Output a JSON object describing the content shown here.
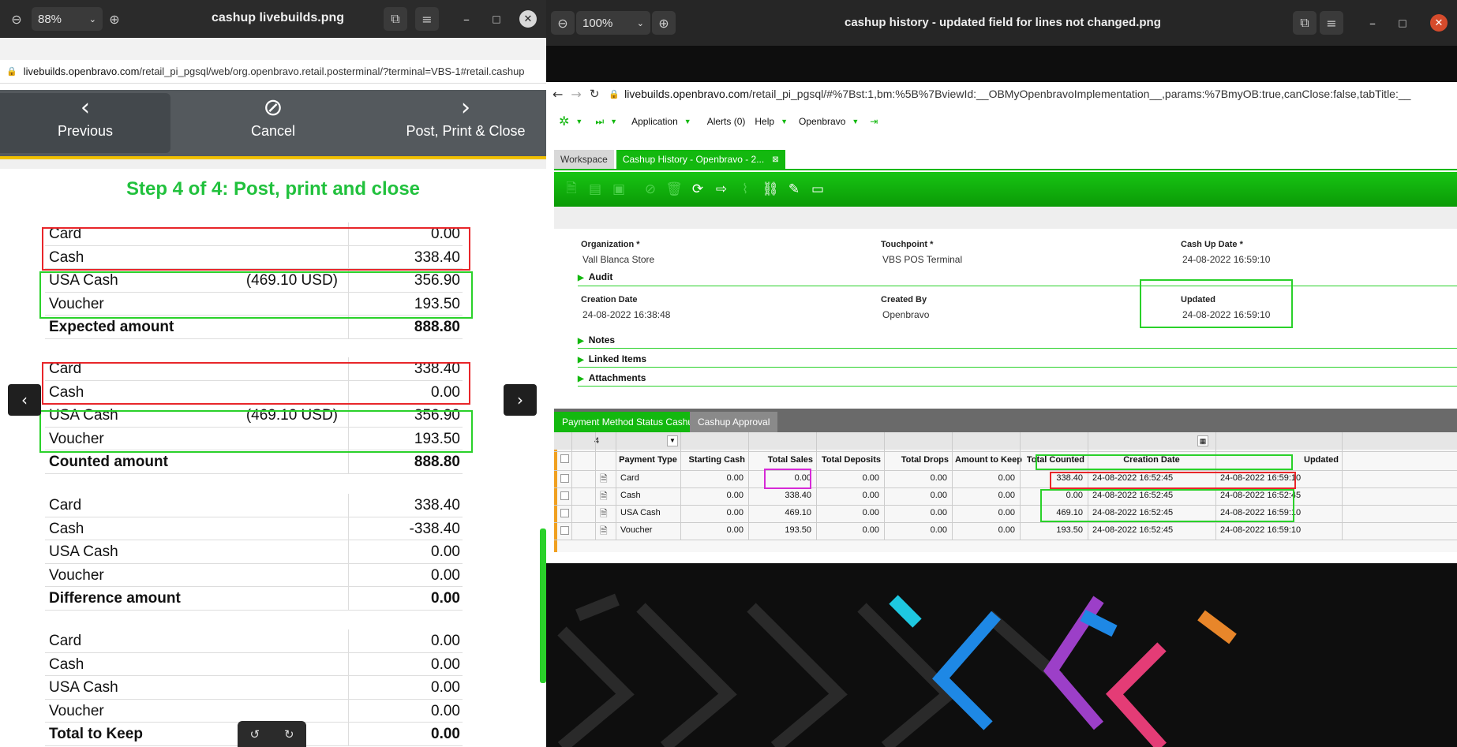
{
  "left_window": {
    "zoom": "88%",
    "title": "cashup livebuilds.png",
    "url_host": "livebuilds.openbravo.com",
    "url_path": "/retail_pi_pgsql/web/org.openbravo.retail.posterminal/?terminal=VBS-1#retail.cashup",
    "toolbar": {
      "previous": "Previous",
      "cancel": "Cancel",
      "post": "Post, Print & Close"
    },
    "step_title": "Step 4 of 4: Post, print and close",
    "expected": [
      {
        "name": "Card",
        "extra": "",
        "value": "0.00"
      },
      {
        "name": "Cash",
        "extra": "",
        "value": "338.40"
      },
      {
        "name": "USA Cash",
        "extra": "(469.10 USD)",
        "value": "356.90"
      },
      {
        "name": "Voucher",
        "extra": "",
        "value": "193.50"
      },
      {
        "name": "Expected amount",
        "extra": "",
        "value": "888.80"
      }
    ],
    "counted": [
      {
        "name": "Card",
        "extra": "",
        "value": "338.40"
      },
      {
        "name": "Cash",
        "extra": "",
        "value": "0.00"
      },
      {
        "name": "USA Cash",
        "extra": "(469.10 USD)",
        "value": "356.90"
      },
      {
        "name": "Voucher",
        "extra": "",
        "value": "193.50"
      },
      {
        "name": "Counted amount",
        "extra": "",
        "value": "888.80"
      }
    ],
    "difference": [
      {
        "name": "Card",
        "extra": "",
        "value": "338.40"
      },
      {
        "name": "Cash",
        "extra": "",
        "value": "-338.40"
      },
      {
        "name": "USA Cash",
        "extra": "",
        "value": "0.00"
      },
      {
        "name": "Voucher",
        "extra": "",
        "value": "0.00"
      },
      {
        "name": "Difference amount",
        "extra": "",
        "value": "0.00"
      }
    ],
    "keep": [
      {
        "name": "Card",
        "extra": "",
        "value": "0.00"
      },
      {
        "name": "Cash",
        "extra": "",
        "value": "0.00"
      },
      {
        "name": "USA Cash",
        "extra": "",
        "value": "0.00"
      },
      {
        "name": "Voucher",
        "extra": "",
        "value": "0.00"
      },
      {
        "name": "Total to Keep",
        "extra": "",
        "value": "0.00"
      }
    ]
  },
  "right_window": {
    "zoom": "100%",
    "title": "cashup history - updated field for lines not changed.png",
    "url_host": "livebuilds.openbravo.com",
    "url_path": "/retail_pi_pgsql/#%7Bst:1,bm:%5B%7BviewId:__OBMyOpenbravoImplementation__,params:%7BmyOB:true,canClose:false,tabTitle:__",
    "menu": {
      "application": "Application",
      "alerts": "Alerts (0)",
      "help": "Help",
      "openbravo": "Openbravo"
    },
    "tabs": {
      "workspace": "Workspace",
      "cashup": "Cashup History - Openbravo - 2..."
    },
    "form": {
      "organization_label": "Organization *",
      "organization": "Vall Blanca Store",
      "touchpoint_label": "Touchpoint *",
      "touchpoint": "VBS POS Terminal",
      "cashupdate_label": "Cash Up Date *",
      "cashupdate": "24-08-2022 16:59:10",
      "audit": "Audit",
      "creation_label": "Creation Date",
      "creation": "24-08-2022 16:38:48",
      "createdby_label": "Created By",
      "createdby": "Openbravo",
      "updated_label": "Updated",
      "updated": "24-08-2022 16:59:10",
      "notes": "Notes",
      "linked": "Linked Items",
      "attachments": "Attachments"
    },
    "subtabs": {
      "pms": "Payment Method Status Cashup",
      "approval": "Cashup Approval"
    },
    "grid": {
      "count": "4",
      "headers": [
        "Payment Type",
        "Starting Cash",
        "Total Sales",
        "Total Deposits",
        "Total Drops",
        "Amount to Keep",
        "Total Counted",
        "Creation Date",
        "Updated"
      ],
      "rows": [
        [
          "Card",
          "0.00",
          "0.00",
          "0.00",
          "0.00",
          "0.00",
          "338.40",
          "24-08-2022 16:52:45",
          "24-08-2022 16:59:10"
        ],
        [
          "Cash",
          "0.00",
          "338.40",
          "0.00",
          "0.00",
          "0.00",
          "0.00",
          "24-08-2022 16:52:45",
          "24-08-2022 16:52:45"
        ],
        [
          "USA Cash",
          "0.00",
          "469.10",
          "0.00",
          "0.00",
          "0.00",
          "469.10",
          "24-08-2022 16:52:45",
          "24-08-2022 16:59:10"
        ],
        [
          "Voucher",
          "0.00",
          "193.50",
          "0.00",
          "0.00",
          "0.00",
          "193.50",
          "24-08-2022 16:52:45",
          "24-08-2022 16:59:10"
        ]
      ]
    }
  }
}
